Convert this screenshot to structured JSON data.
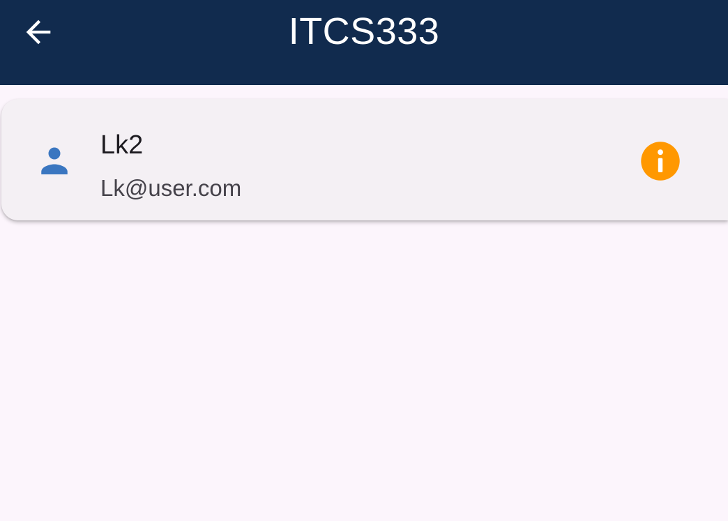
{
  "app_bar": {
    "title": "ITCS333",
    "back_icon": "arrow-left-icon",
    "background_color": "#112b4e"
  },
  "user_card": {
    "icon": "person-icon",
    "icon_color": "#3a76c0",
    "name": "Lk2",
    "email": "Lk@user.com",
    "info_icon": "info-icon",
    "info_color": "#ff9800"
  }
}
